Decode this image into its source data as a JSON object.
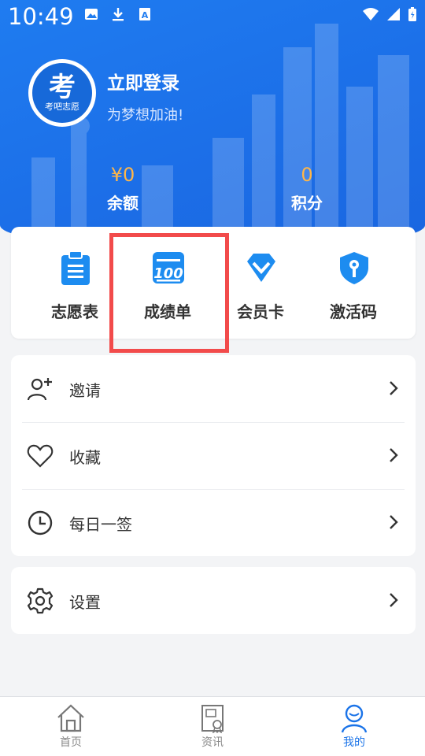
{
  "status_bar": {
    "time": "10:49"
  },
  "profile": {
    "avatar_big": "考",
    "avatar_small": "考吧志愿",
    "login_text": "立即登录",
    "slogan": "为梦想加油!"
  },
  "stats": [
    {
      "value": "¥0",
      "label": "余额"
    },
    {
      "value": "0",
      "label": "积分"
    }
  ],
  "quick_actions": [
    {
      "label": "志愿表",
      "icon": "clipboard-icon"
    },
    {
      "label": "成绩单",
      "icon": "score-100-icon"
    },
    {
      "label": "会员卡",
      "icon": "diamond-icon"
    },
    {
      "label": "激活码",
      "icon": "shield-key-icon"
    }
  ],
  "menu": [
    {
      "label": "邀请",
      "icon": "add-user-icon"
    },
    {
      "label": "收藏",
      "icon": "heart-icon"
    },
    {
      "label": "每日一签",
      "icon": "clock-icon"
    }
  ],
  "settings": {
    "label": "设置",
    "icon": "gear-icon"
  },
  "tabs": [
    {
      "label": "首页",
      "icon": "home-icon",
      "active": false
    },
    {
      "label": "资讯",
      "icon": "news-icon",
      "active": false
    },
    {
      "label": "我的",
      "icon": "user-icon",
      "active": true
    }
  ],
  "colors": {
    "header_blue": "#1f7cf0",
    "accent_orange": "#ffb648",
    "active_tab": "#1a73e8",
    "highlight_red": "#f24b4b"
  }
}
